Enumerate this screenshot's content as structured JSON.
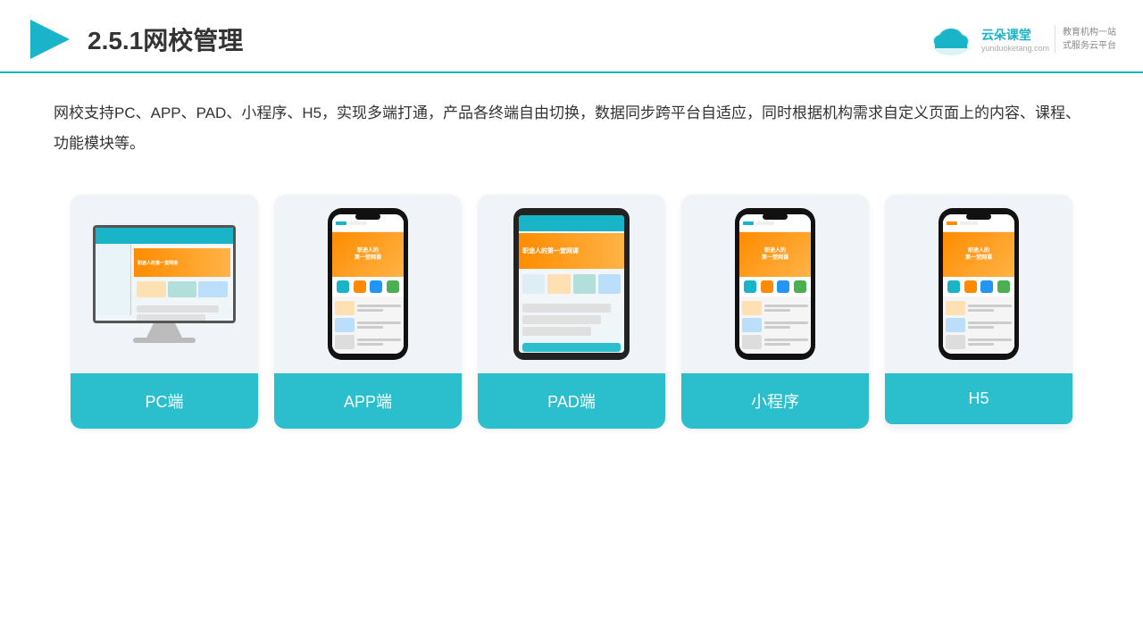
{
  "header": {
    "title": "2.5.1网校管理",
    "logo_name": "云朵课堂",
    "logo_sub": "yunduoketang.com",
    "logo_tagline": "教育机构一站\n式服务云平台"
  },
  "description": {
    "text": "网校支持PC、APP、PAD、小程序、H5，实现多端打通，产品各终端自由切换，数据同步跨平台自适应，同时根据机构需求自定义页面上的内容、课程、功能模块等。"
  },
  "cards": [
    {
      "id": "pc",
      "label": "PC端"
    },
    {
      "id": "app",
      "label": "APP端"
    },
    {
      "id": "pad",
      "label": "PAD端"
    },
    {
      "id": "miniprogram",
      "label": "小程序"
    },
    {
      "id": "h5",
      "label": "H5"
    }
  ],
  "accent_color": "#2bbfce",
  "header_line_color": "#1ab4c8"
}
